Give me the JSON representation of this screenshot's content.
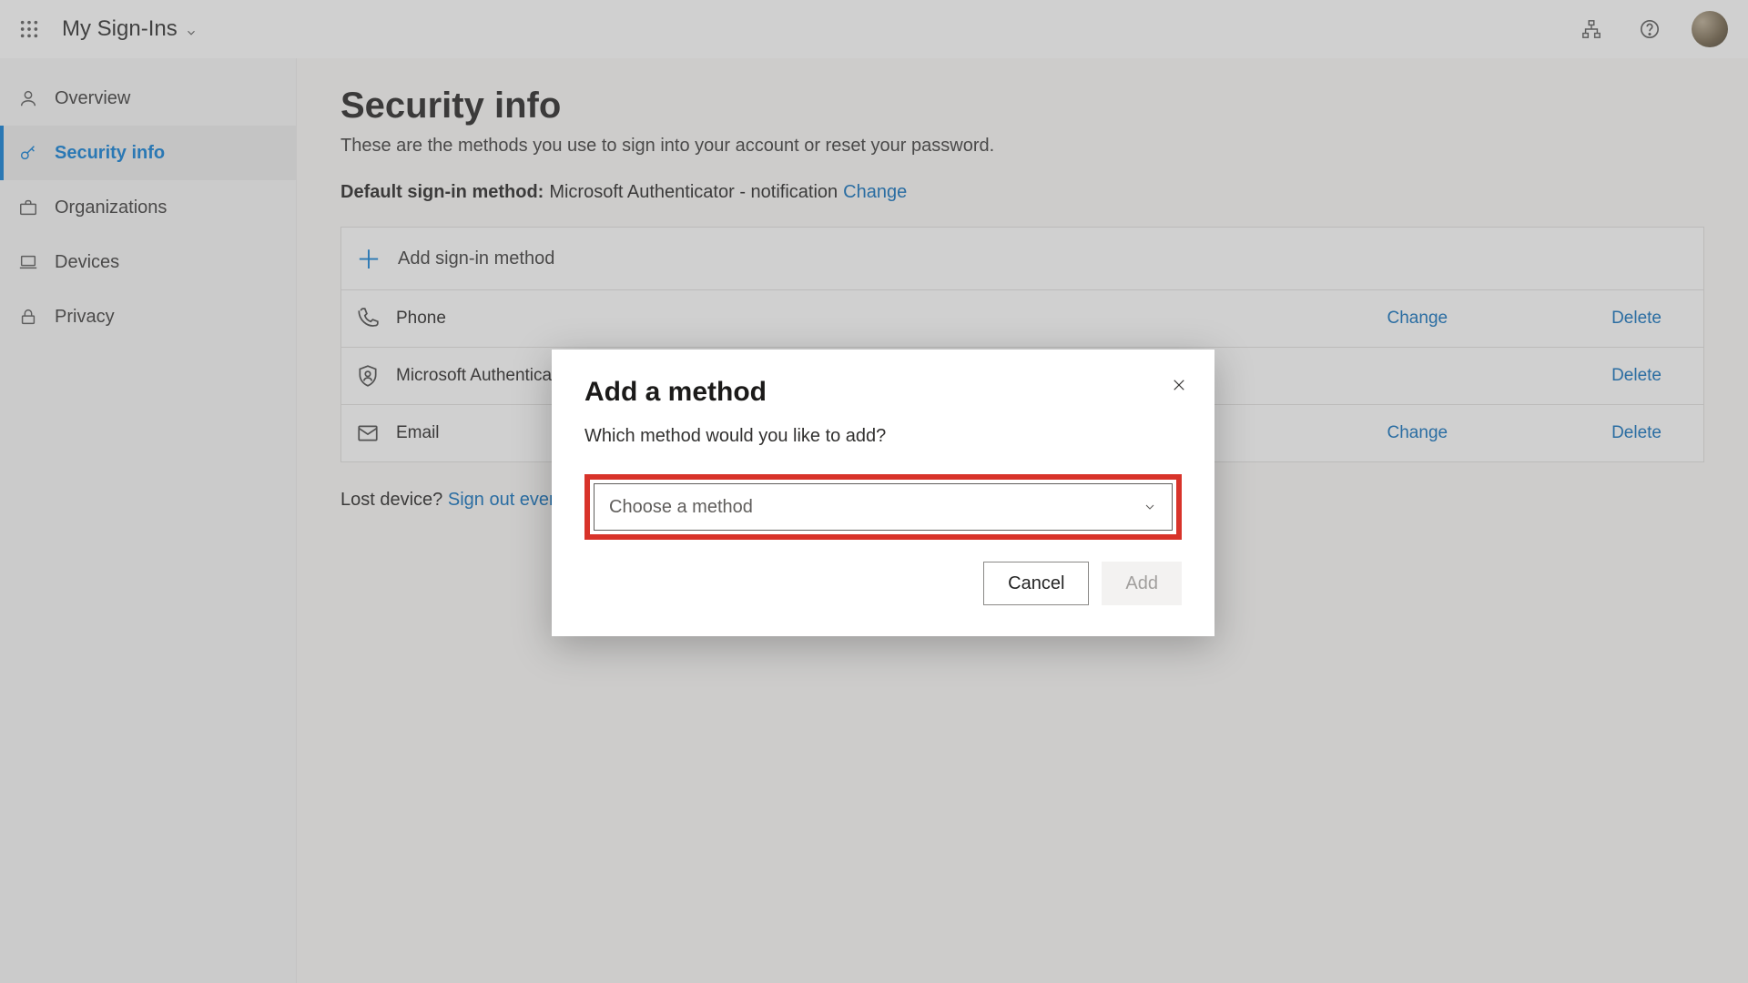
{
  "header": {
    "title": "My Sign-Ins"
  },
  "sidebar": {
    "items": [
      {
        "label": "Overview"
      },
      {
        "label": "Security info"
      },
      {
        "label": "Organizations"
      },
      {
        "label": "Devices"
      },
      {
        "label": "Privacy"
      }
    ]
  },
  "main": {
    "page_title": "Security info",
    "subtitle": "These are the methods you use to sign into your account or reset your password.",
    "default_label": "Default sign-in method:",
    "default_value": "Microsoft Authenticator - notification",
    "change_link": "Change",
    "add_method_label": "Add sign-in method",
    "methods": [
      {
        "label": "Phone",
        "change": "Change",
        "delete": "Delete",
        "icon": "phone"
      },
      {
        "label": "Microsoft Authenticator",
        "change": "",
        "delete": "Delete",
        "icon": "authenticator"
      },
      {
        "label": "Email",
        "change": "Change",
        "delete": "Delete",
        "icon": "mail"
      }
    ],
    "lost_label": "Lost device?",
    "signout_link": "Sign out everywhere"
  },
  "modal": {
    "title": "Add a method",
    "subtitle": "Which method would you like to add?",
    "dropdown_placeholder": "Choose a method",
    "cancel": "Cancel",
    "add": "Add"
  }
}
